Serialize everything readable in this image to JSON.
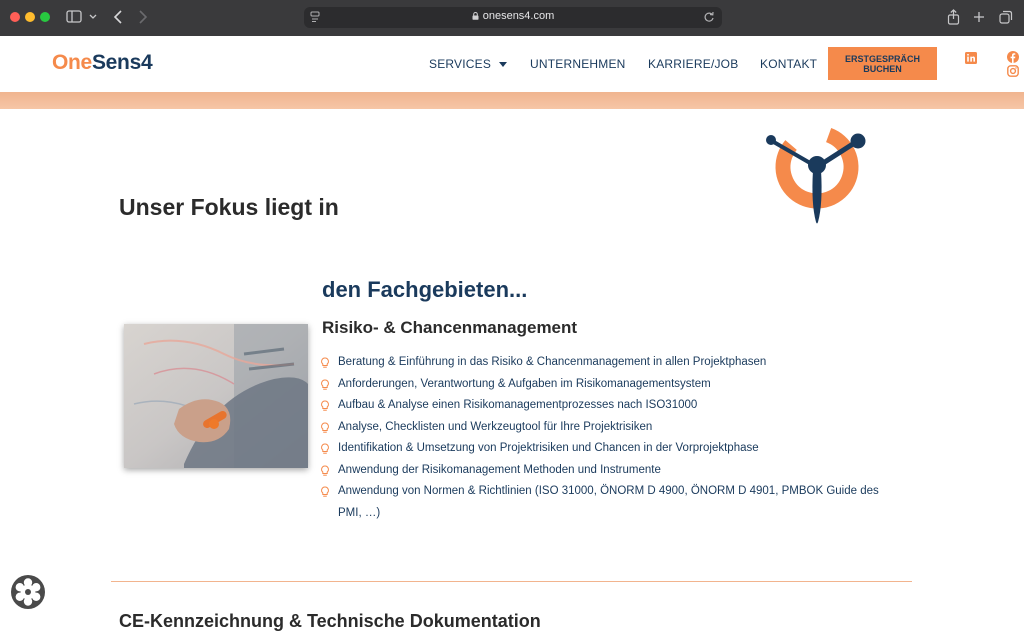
{
  "browser": {
    "url": "onesens4.com"
  },
  "header": {
    "logo_one": "One",
    "logo_sens": "Sens4",
    "nav": [
      {
        "label": "SERVICES"
      },
      {
        "label": "UNTERNEHMEN"
      },
      {
        "label": "KARRIERE/JOB"
      },
      {
        "label": "KONTAKT"
      }
    ],
    "cta_line1": "ERSTGESPRÄCH",
    "cta_line2": "BUCHEN",
    "social": [
      "linkedin-icon",
      "facebook-icon",
      "instagram-icon"
    ]
  },
  "main": {
    "hero_title": "Unser Fokus liegt in",
    "section_title": "den Fachgebieten...",
    "subsection_title": "Risiko- & Chancenmanagement",
    "bullets": [
      "Beratung & Einführung in das Risiko & Chancenmanagement in allen Projektphasen",
      "Anforderungen, Verantwortung & Aufgaben im Risikomanagementsystem",
      "Aufbau & Analyse einen Risikomanagementprozesses nach ISO31000",
      "Analyse, Checklisten und Werkzeugtool für Ihre Projektrisiken",
      "Identifikation & Umsetzung von Projektrisiken und Chancen in der Vorprojektphase",
      "Anwendung der Risikomanagement Methoden und Instrumente",
      "Anwendung von Normen & Richtlinien (ISO 31000, ÖNORM D 4900, ÖNORM D 4901, PMBOK Guide des PMI, …)"
    ],
    "next_section_title": "CE-Kennzeichnung & Technische Dokumentation"
  },
  "colors": {
    "brand_navy": "#1a3a5c",
    "brand_orange": "#f58a4b"
  }
}
